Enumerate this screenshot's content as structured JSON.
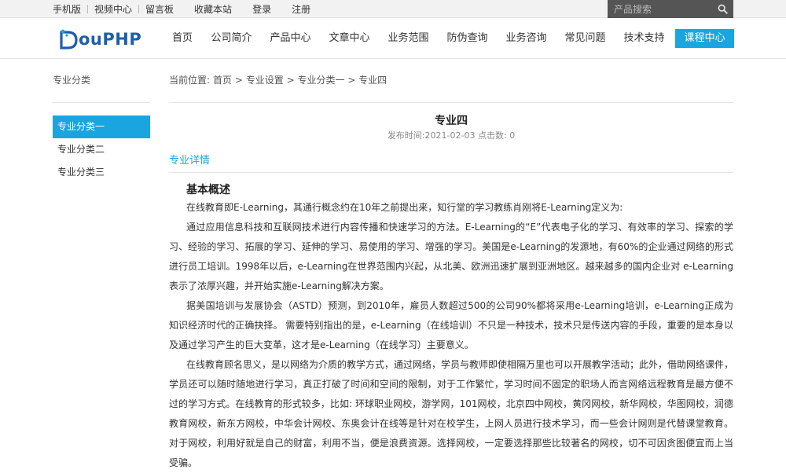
{
  "topbar": {
    "links": [
      "手机版",
      "视频中心",
      "留言板",
      "收藏本站",
      "登录",
      "注册"
    ],
    "search_placeholder": "产品搜索"
  },
  "header": {
    "logo_text": "ouPHP",
    "nav": [
      "首页",
      "公司简介",
      "产品中心",
      "文章中心",
      "业务范围",
      "防伪查询",
      "业务咨询",
      "常见问题",
      "技术支持",
      "课程中心"
    ],
    "active_nav": "课程中心"
  },
  "sidebar": {
    "title": "专业分类",
    "items": [
      "专业分类一",
      "专业分类二",
      "专业分类三"
    ]
  },
  "breadcrumb": {
    "prefix": "当前位置:",
    "items": [
      "首页",
      "专业设置",
      "专业分类一",
      "专业四"
    ],
    "separator": " > "
  },
  "article": {
    "title": "专业四",
    "publish_label": "发布时间:",
    "publish_date": "2021-02-03",
    "clicks_label": "点击数:",
    "clicks": "0",
    "detail_heading": "专业详情",
    "section_title": "基本概述",
    "paragraphs": [
      "在线教育即E-Learning，其通行概念约在10年之前提出来，知行堂的学习教练肖刚将E-Learning定义为:",
      "通过应用信息科技和互联网技术进行内容传播和快速学习的方法。E-Learning的“E”代表电子化的学习、有效率的学习、探索的学习、经验的学习、拓展的学习、延伸的学习、易使用的学习、增强的学习。美国是e-Learning的发源地，有60%的企业通过网络的形式进行员工培训。1998年以后，e-Learning在世界范围内兴起，从北美、欧洲迅速扩展到亚洲地区。越来越多的国内企业对 e-Learning表示了浓厚兴趣，并开始实施e-Learning解决方案。",
      "据美国培训与发展协会（ASTD）预测，到2010年，雇员人数超过500的公司90%都将采用e-Learning培训，e-Learning正成为知识经济时代的正确抉择。 需要特别指出的是，e-Learning（在线培训）不只是一种技术，技术只是传送内容的手段，重要的是本身以及通过学习产生的巨大变革，这才是e-Learning（在线学习）主要意义。",
      "在线教育顾名思义，是以网络为介质的教学方式，通过网络，学员与教师即使相隔万里也可以开展教学活动；此外，借助网络课件，学员还可以随时随地进行学习，真正打破了时间和空间的限制，对于工作繁忙，学习时间不固定的职场人而言网络远程教育是最方便不过的学习方式。在线教育的形式较多，比如: 环球职业网校，游学网，101网校，北京四中网校，黄冈网校，新华网校，华图网校，润德教育网校，新东方网校，中华会计网校、东奥会计在线等是针对在校学生，上网人员进行技术学习，而一些会计网则是代替课堂教育。对于网校，利用好就是自己的财富，利用不当，便是浪费资源。选择网校，一定要选择那些比较著名的网校，切不可因贪图便宜而上当受骗。"
    ]
  },
  "colors": {
    "accent": "#1aa5e0",
    "logo": "#1e5fa8",
    "topbar_bg": "#f2f2f2",
    "search_bg": "#555555"
  }
}
